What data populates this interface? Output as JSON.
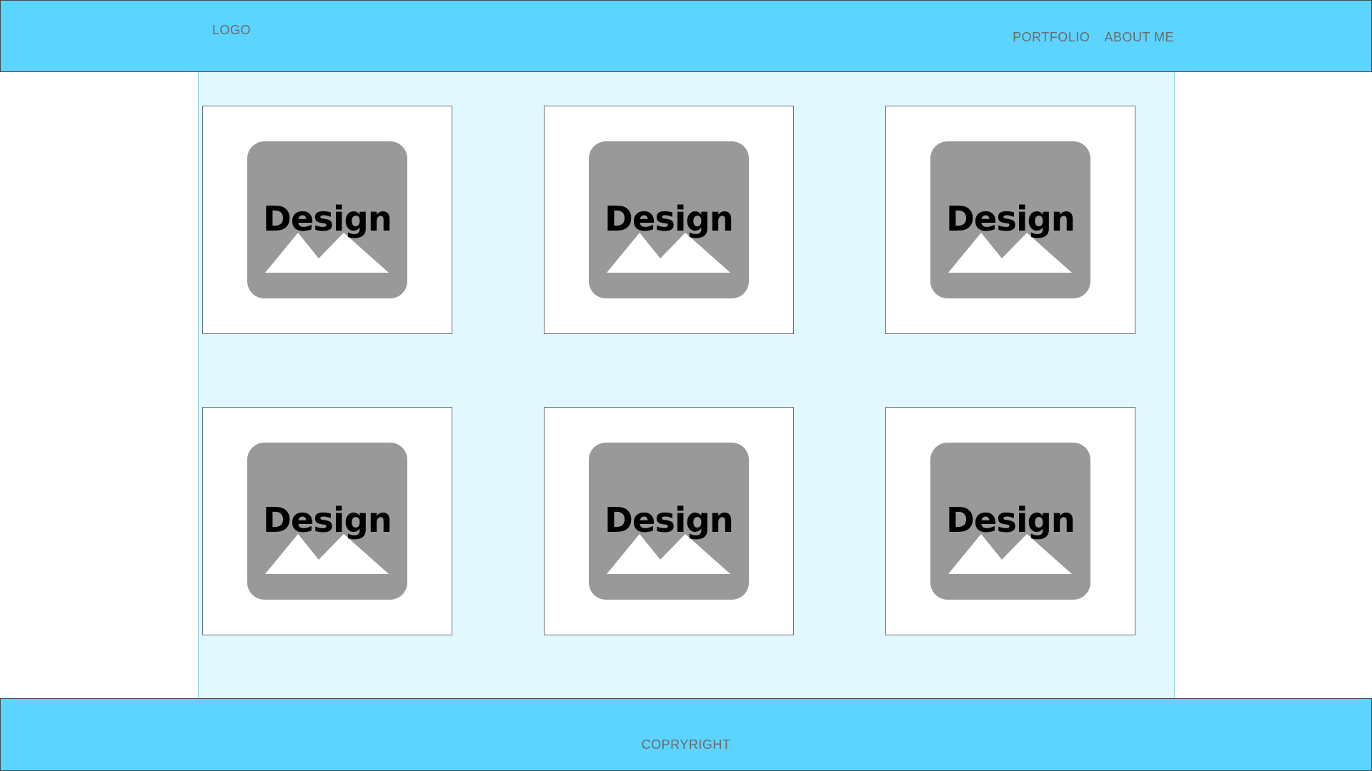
{
  "header": {
    "logo": "LOGO",
    "nav": {
      "portfolio": "PORTFOLIO",
      "about": "ABOUT ME"
    }
  },
  "gallery": {
    "items": [
      {
        "label": "Design",
        "icon": "image-placeholder-icon"
      },
      {
        "label": "Design",
        "icon": "image-placeholder-icon"
      },
      {
        "label": "Design",
        "icon": "image-placeholder-icon"
      },
      {
        "label": "Design",
        "icon": "image-placeholder-icon"
      },
      {
        "label": "Design",
        "icon": "image-placeholder-icon"
      },
      {
        "label": "Design",
        "icon": "image-placeholder-icon"
      }
    ]
  },
  "footer": {
    "copyright": "COPRYRIGHT"
  },
  "colors": {
    "header_bg": "#5bd4ff",
    "content_bg": "#e1f8ff",
    "placeholder_bg": "#999999",
    "text_muted": "#6b6b6b"
  }
}
